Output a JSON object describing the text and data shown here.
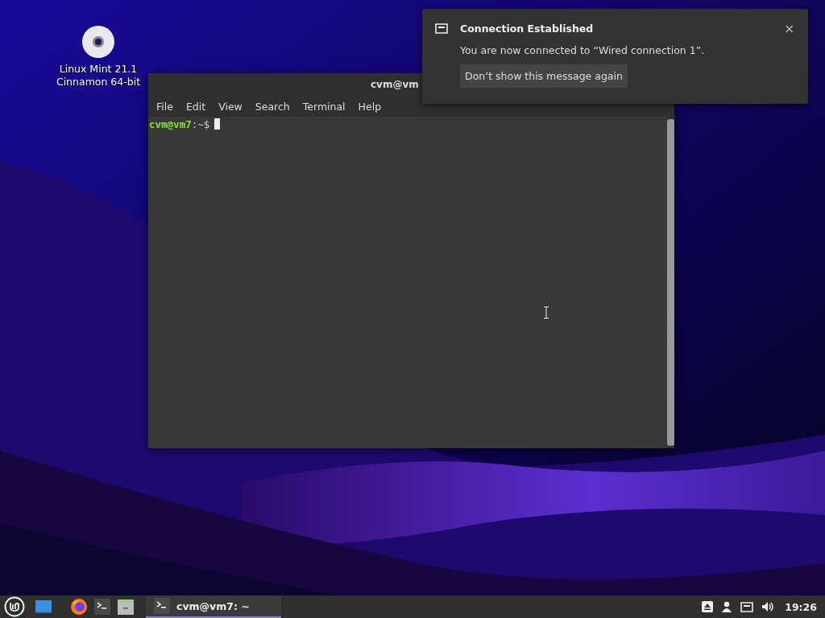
{
  "desktop_icons": [
    {
      "label": "Linux Mint 21.1\nCinnamon 64-bit"
    }
  ],
  "terminal": {
    "title": "cvm@vm",
    "menu": [
      "File",
      "Edit",
      "View",
      "Search",
      "Terminal",
      "Help"
    ],
    "prompt": {
      "user_host": "cvm@vm7",
      "separator": ":",
      "path": "~",
      "symbol": "$"
    }
  },
  "notification": {
    "title": "Connection Established",
    "body": "You are now connected to “Wired connection 1”.",
    "button": "Don’t show this message again",
    "close": "×"
  },
  "taskbar": {
    "launchers": [
      {
        "kind": "desktop"
      },
      {
        "kind": "browser"
      },
      {
        "kind": "terminal"
      },
      {
        "kind": "files"
      }
    ],
    "windows": [
      {
        "label": "cvm@vm7: ~",
        "selected": true
      }
    ],
    "tray": [
      {
        "kind": "eject"
      },
      {
        "kind": "user"
      },
      {
        "kind": "network"
      },
      {
        "kind": "volume"
      }
    ],
    "clock": "19:26"
  }
}
